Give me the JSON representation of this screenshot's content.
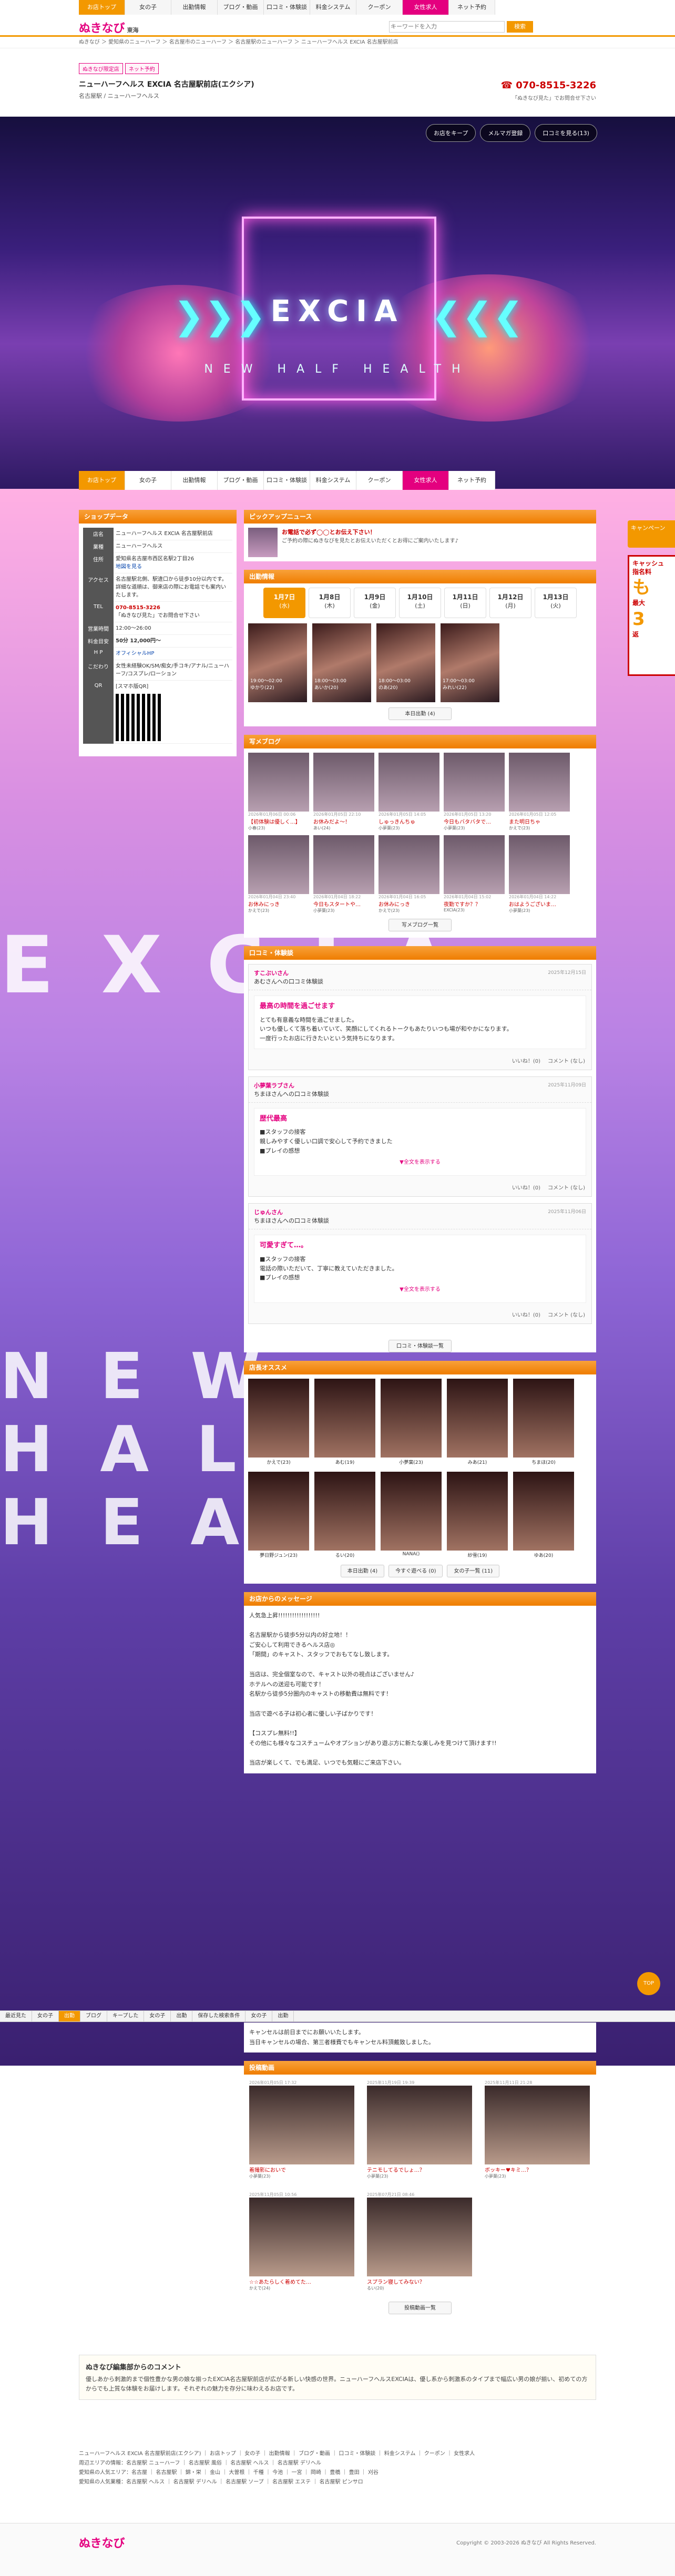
{
  "site": {
    "logo": "ぬきなび",
    "region": "東海"
  },
  "gnav": [
    "お店トップ",
    "女の子",
    "出勤情報",
    "ブログ・動画",
    "口コミ・体験談",
    "料金システム",
    "クーポン",
    "女性求人",
    "ネット予約"
  ],
  "search": {
    "placeholder": "キーワードを入力",
    "button": "検索"
  },
  "crumb": "ぬきなび ＞ 愛知県のニューハーフ ＞ 名古屋市のニューハーフ ＞ 名古屋駅のニューハーフ ＞ ニューハーフヘルス EXCIA 名古屋駅前店",
  "shop": {
    "tags": [
      "ぬきなび限定店",
      "ネット予約"
    ],
    "name": "ニューハーフヘルス EXCIA 名古屋駅前店(エクシア)",
    "area": "名古屋駅 / ニューハーフヘルス",
    "tel": "070-8515-3226",
    "telsub": "「ぬきなび見た」でお問合せ下さい"
  },
  "hero": {
    "brand": "EXCIA",
    "sub": "NEW HALF HEALTH",
    "buttons": [
      "お店をキープ",
      "メルマガ登録",
      "口コミを見る(13)"
    ]
  },
  "shopdata": {
    "title": "ショップデータ",
    "rows": [
      {
        "k": "店名",
        "v": "ニューハーフヘルス EXCIA 名古屋駅前店"
      },
      {
        "k": "業種",
        "v": "ニューハーフヘルス"
      },
      {
        "k": "住所",
        "v": "愛知県名古屋市西区名駅2丁目26"
      },
      {
        "k": "アクセス",
        "v": "名古屋駅北側、駅違口から徒歩10分以内です。詳細な道順は、御来店の際にお電話でも案内いたします。"
      },
      {
        "k": "TEL",
        "v": "070-8515-3226"
      },
      {
        "k": "営業時間",
        "v": "12:00〜26:00"
      },
      {
        "k": "料金目安",
        "v": "50分 12,000円〜"
      },
      {
        "k": "H P",
        "v": "オフィシャルHP"
      },
      {
        "k": "こだわり",
        "v": "女性未経験OK/SM/痴女/手コキ/アナル/ニューハーフ/コスプレ/ローション"
      },
      {
        "k": "QR",
        "v": "[スマホ版QR]"
      }
    ],
    "maplink": "地図を見る",
    "telnote": "「ぬきなび見た」でお問合せ下さい"
  },
  "pickup": {
    "title": "ピックアップニュース",
    "head": "お電話で必ず◯◯とお伝え下さい！",
    "text": "ご予約の際にぬきなびを見たとお伝えいただくとお得にご案内いたします♪"
  },
  "schedule": {
    "title": "出勤情報",
    "days": [
      {
        "d": "1月7日",
        "w": "(水)"
      },
      {
        "d": "1月8日",
        "w": "(木)"
      },
      {
        "d": "1月9日",
        "w": "(金)"
      },
      {
        "d": "1月10日",
        "w": "(土)"
      },
      {
        "d": "1月11日",
        "w": "(日)"
      },
      {
        "d": "1月12日",
        "w": "(月)"
      },
      {
        "d": "1月13日",
        "w": "(火)"
      }
    ],
    "casts": [
      {
        "t": "19:00〜02:00",
        "n": "ゆかり(22)"
      },
      {
        "t": "18:00〜03:00",
        "n": "あいか(20)"
      },
      {
        "t": "18:00〜03:00",
        "n": "のあ(20)"
      },
      {
        "t": "17:00〜03:00",
        "n": "みれい(22)"
      }
    ],
    "more": "本日出勤 (4)"
  },
  "blog": {
    "title": "写メブログ",
    "items": [
      {
        "d": "2026年01月06日 00:06",
        "t": "【初体験は優しく...】",
        "n": "小春(23)"
      },
      {
        "d": "2026年01月05日 22:10",
        "t": "お休みだよ〜！",
        "n": "あい(24)"
      },
      {
        "d": "2026年01月05日 14:05",
        "t": "しゅっきんちゅ",
        "n": "小夢葉(23)"
      },
      {
        "d": "2026年01月05日 13:20",
        "t": "今日もバタバタで…",
        "n": "小夢葉(23)"
      },
      {
        "d": "2026年01月05日 12:05",
        "t": "また明日ちゃ",
        "n": "かえで(23)"
      },
      {
        "d": "2026年01月04日 23:40",
        "t": "お休みにっき",
        "n": "かえで(23)"
      },
      {
        "d": "2026年01月04日 18:22",
        "t": "今日もスタートや…",
        "n": "小夢葉(23)"
      },
      {
        "d": "2026年01月04日 16:05",
        "t": "お休みにっき",
        "n": "かえで(23)"
      },
      {
        "d": "2026年01月04日 15:02",
        "t": "夜勤ですか？？",
        "n": "EXCIA(23)"
      },
      {
        "d": "2026年01月04日 14:22",
        "t": "おはようございま…",
        "n": "小夢葉(23)"
      }
    ],
    "more": "写メブログ一覧"
  },
  "reviews": {
    "title": "口コミ・体験談",
    "items": [
      {
        "u": "すこぶいさん",
        "s": "あむさんへの口コミ体験談",
        "dt": "2025年12月15日",
        "tt": "最高の時間を過ごせます",
        "body": "とても有意義な時間を過ごせました。\nいつも優しくて落ち着いていて、笑顔にしてくれるトークもあたりいつも場が和やかになります。\n一度行ったお店に行きたいという気持ちになります。",
        "like": "いいね！(0)",
        "cmt": "コメント (なし)",
        "more": ""
      },
      {
        "u": "小夢葉ラブさん",
        "s": "ちまほさんへの口コミ体験談",
        "dt": "2025年11月09日",
        "tt": "歴代最高",
        "body": "■スタッフの接客\n親しみやすく優しい口調で安心して予約できました\n■プレイの感想",
        "like": "いいね！(0)",
        "cmt": "コメント (なし)",
        "more": "▼全文を表示する"
      },
      {
        "u": "じゅんさん",
        "s": "ちまほさんへの口コミ体験談",
        "dt": "2025年11月06日",
        "tt": "可愛すぎて…。",
        "body": "■スタッフの接客\n電話の際いただいて、丁寧に教えていただきました。\n■プレイの感想",
        "like": "いいね！(0)",
        "cmt": "コメント (なし)",
        "more": "▼全文を表示する"
      }
    ],
    "more": "口コミ・体験談一覧"
  },
  "recommend": {
    "title": "店長オススメ",
    "items": [
      "かえで(23)",
      "あむ(19)",
      "小夢葉(23)",
      "みあ(21)",
      "ちまほ(20)",
      "夢日野ジュン(23)",
      "るい(20)",
      "NANA()",
      "紗雪(19)",
      "ゆあ(20)"
    ],
    "buttons": [
      "本日出勤 (4)",
      "今すぐ遊べる (0)",
      "女の子一覧 (11)"
    ]
  },
  "message": {
    "title": "お店からのメッセージ",
    "lines": [
      "人気急上昇!!!!!!!!!!!!!!!!!!",
      "",
      "名古屋駅から徒歩5分以内の好立地！！",
      "ご安心して利用できるヘルス店◎",
      "「期間」のキャスト、スタッフでおもてなし致します。",
      "",
      "当店は、完全個室なので、キャスト以外の視点はございません♪",
      "ホテルへの送迎も可能です！",
      "名駅から徒歩5分圏内のキャストの移動費は無料です！",
      "",
      "当店で遊べる子は初心者に優しい子ばかりです！",
      "",
      "【コスプレ無料!!】",
      "その他にも様々なコスチュームやオプションがあり遊ぶ方に新たな楽しみを見つけて頂けます!!",
      "",
      "当店が楽しくて、でも満足、いつでも気軽にご来店下さい。"
    ],
    "cancel": [
      "キャンセルは前日までにお願いいたします。",
      "当日キャンセルの場合、第三者様費でもキャンセル料頂戴致しました。"
    ]
  },
  "posts": {
    "title": "投稿動画",
    "items": [
      {
        "d": "2026年01月05日 17:32",
        "t": "着撮影においで",
        "n": "小夢葉(23)"
      },
      {
        "d": "2025年11月19日 19:39",
        "t": "テニモしてるでしょ…？",
        "n": "小夢葉(23)"
      },
      {
        "d": "2025年11月11日 21:28",
        "t": "ボッキー♥キミ…？",
        "n": "小夢葉(23)"
      },
      {
        "d": "2025年11月05日 10:56",
        "t": "☆☆あたらしく着めてた…",
        "n": "かえで(24)"
      },
      {
        "d": "2025年07月21日 08:46",
        "t": "スプラン寝してみない？",
        "n": "るい(20)"
      }
    ],
    "more": "投稿動画一覧"
  },
  "editor": {
    "h": "ぬきなび編集部からのコメント",
    "p": "優しあから刺激的まで個性豊かな男の娘な揃ったEXCIA名古屋駅前店が広がる新しい快感の世界。ニューハーフヘルスEXCIAは、優し系から刺激系のタイプまで幅広い男の娘が揃い、初めての方からでも上質な体験をお届けします。それぞれの魅力を存分に味わえるお店です。"
  },
  "footlinks": [
    "ニューハーフヘルス EXCIA 名古屋駅前店(エクシア) ｜ お店トップ ｜ 女の子 ｜ 出勤情報 ｜ ブログ・動画 ｜ 口コミ・体験談 ｜ 料金システム ｜ クーポン ｜ 女性求人",
    "周辺エリアの情報：名古屋駅 ニューハーフ ｜ 名古屋駅 風俗 ｜ 名古屋駅 ヘルス ｜ 名古屋駅 デリヘル",
    "愛知県の人気エリア：名古屋 ｜ 名古屋駅 ｜ 錦・栄 ｜ 金山 ｜ 大曽根 ｜ 千種 ｜ 今池 ｜ 一宮 ｜ 岡崎 ｜ 豊橋 ｜ 豊田 ｜ 刈谷",
    "愛知県の人気業種：名古屋駅 ヘルス ｜ 名古屋駅 デリヘル ｜ 名古屋駅 ソープ ｜ 名古屋駅 エステ ｜ 名古屋駅 ピンサロ"
  ],
  "sidebar": {
    "a": "キャンペーン",
    "b1": "キャッシュ",
    "b2": "指名料",
    "b3": "も",
    "b4": "最大",
    "b5": "3",
    "b6": "返"
  },
  "stickybar": [
    "最近見た",
    "女の子",
    "出勤",
    "ブログ",
    "キープした",
    "女の子",
    "出勤",
    "保存した検索条件",
    "女の子",
    "出勤"
  ],
  "pagetop": "TOP",
  "footer": {
    "logo": "ぬきなび",
    "copy": "Copyright © 2003-2026 ぬきなび All Rights Reserved."
  }
}
